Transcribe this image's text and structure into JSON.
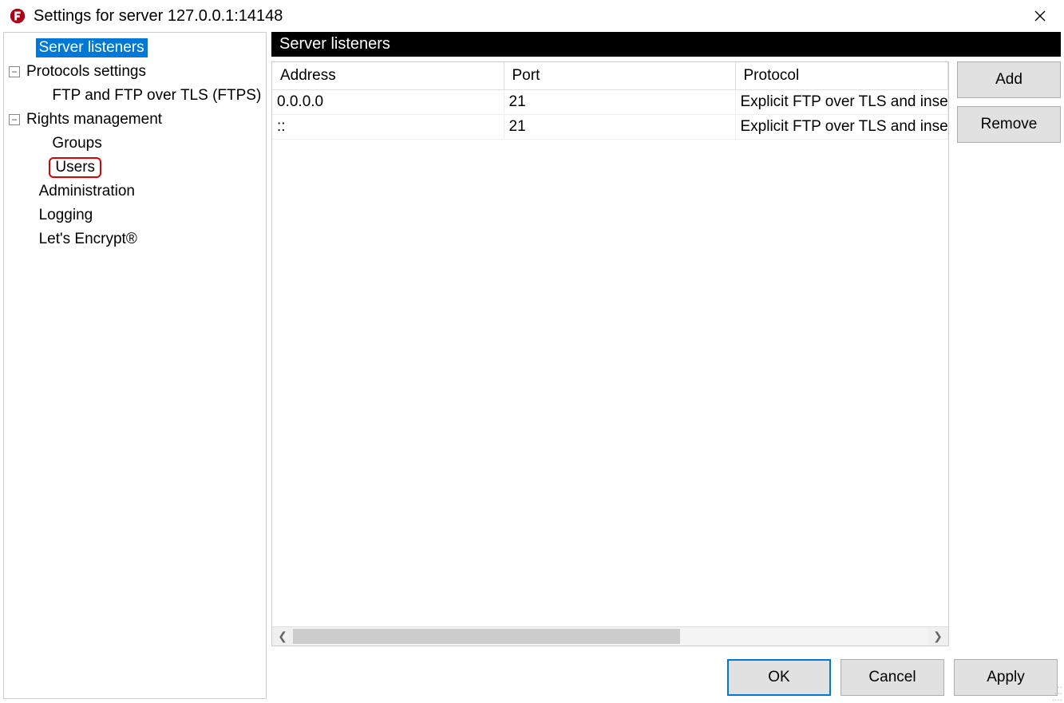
{
  "title": "Settings for server 127.0.0.1:14148",
  "tree": {
    "server_listeners": "Server listeners",
    "protocols_settings": "Protocols settings",
    "ftp_ftps": "FTP and FTP over TLS (FTPS)",
    "rights_management": "Rights management",
    "groups": "Groups",
    "users": "Users",
    "administration": "Administration",
    "logging": "Logging",
    "lets_encrypt": "Let's Encrypt®"
  },
  "content": {
    "header": "Server listeners",
    "columns": {
      "address": "Address",
      "port": "Port",
      "protocol": "Protocol"
    },
    "rows": [
      {
        "address": "0.0.0.0",
        "port": "21",
        "protocol": "Explicit FTP over TLS and insecure plain FTP"
      },
      {
        "address": "::",
        "port": "21",
        "protocol": "Explicit FTP over TLS and insecure plain FTP"
      }
    ],
    "buttons": {
      "add": "Add",
      "remove": "Remove"
    }
  },
  "bottom": {
    "ok": "OK",
    "cancel": "Cancel",
    "apply": "Apply"
  }
}
